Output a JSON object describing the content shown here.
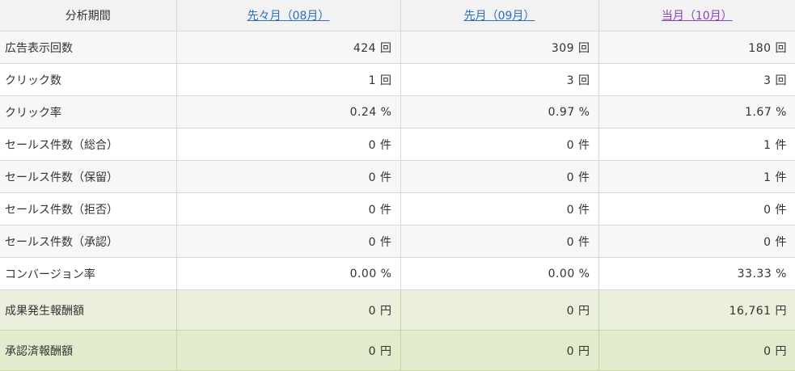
{
  "colors": {
    "header_bg": "#f2f2f2",
    "row_alt_bg": "#f7f7f7",
    "green_row_bg": "#ebf0dc",
    "link_blue": "#2a6fba",
    "link_visited": "#8a3fb8"
  },
  "header": {
    "label": "分析期間",
    "periods": [
      {
        "label": "先々月（08月）",
        "color": "#2a6fba"
      },
      {
        "label": "先月（09月）",
        "color": "#2a6fba"
      },
      {
        "label": "当月（10月）",
        "color": "#8a3fb8"
      }
    ]
  },
  "rows": [
    {
      "label": "広告表示回数",
      "values": [
        "424 回",
        "309 回",
        "180 回"
      ]
    },
    {
      "label": "クリック数",
      "values": [
        "1 回",
        "3 回",
        "3 回"
      ]
    },
    {
      "label": "クリック率",
      "values": [
        "0.24 %",
        "0.97 %",
        "1.67 %"
      ]
    },
    {
      "label": "セールス件数（総合）",
      "values": [
        "0 件",
        "0 件",
        "1 件"
      ]
    },
    {
      "label": "セールス件数（保留）",
      "values": [
        "0 件",
        "0 件",
        "1 件"
      ]
    },
    {
      "label": "セールス件数（拒否）",
      "values": [
        "0 件",
        "0 件",
        "0 件"
      ]
    },
    {
      "label": "セールス件数（承認）",
      "values": [
        "0 件",
        "0 件",
        "0 件"
      ]
    },
    {
      "label": "コンバージョン率",
      "values": [
        "0.00 %",
        "0.00 %",
        "33.33 %"
      ]
    },
    {
      "label": "成果発生報酬額",
      "values": [
        "0 円",
        "0 円",
        "16,761 円"
      ]
    },
    {
      "label": "承認済報酬額",
      "values": [
        "0 円",
        "0 円",
        "0 円"
      ]
    }
  ]
}
